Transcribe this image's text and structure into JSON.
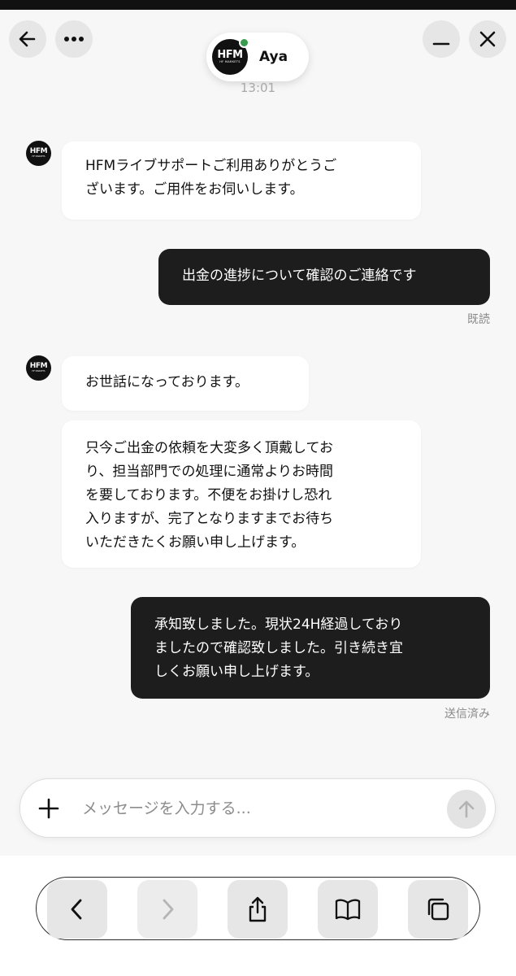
{
  "header": {
    "agent_name": "Aya",
    "avatar_logo": "HFM",
    "avatar_logo_sub": "HF MARKETS",
    "online_color": "#3a9a4e",
    "back_icon": "arrow-left-icon",
    "more_icon": "ellipsis-icon",
    "minimize_icon": "minus-icon",
    "close_icon": "close-icon"
  },
  "timestamp": "13:01",
  "messages": [
    {
      "sender": "agent",
      "text": "HFMライブサポートご利用ありがとうご\nざいます。ご用件をお伺いします。"
    },
    {
      "sender": "user",
      "text": "出金の進捗について確認のご連絡です",
      "status": "既読"
    },
    {
      "sender": "agent",
      "text": "お世話になっております。"
    },
    {
      "sender": "agent",
      "text": "只今ご出金の依頼を大変多く頂戴してお\nり、担当部門での処理に通常よりお時間\nを要しております。不便をお掛けし恐れ\n入りますが、完了となりますまでお待ち\nいただきたくお願い申し上げます。"
    },
    {
      "sender": "user",
      "text": "承知致しました。現状24H経過しており\nましたので確認致しました。引き続き宜\nしくお願い申し上げます。",
      "status": "送信済み"
    }
  ],
  "composer": {
    "placeholder": "メッセージを入力する...",
    "value": "",
    "plus_icon": "plus-icon",
    "send_icon": "arrow-up-icon"
  },
  "browser_toolbar": {
    "buttons": [
      "back-icon",
      "forward-icon",
      "share-icon",
      "bookmarks-icon",
      "tabs-icon"
    ],
    "forward_disabled": true
  }
}
